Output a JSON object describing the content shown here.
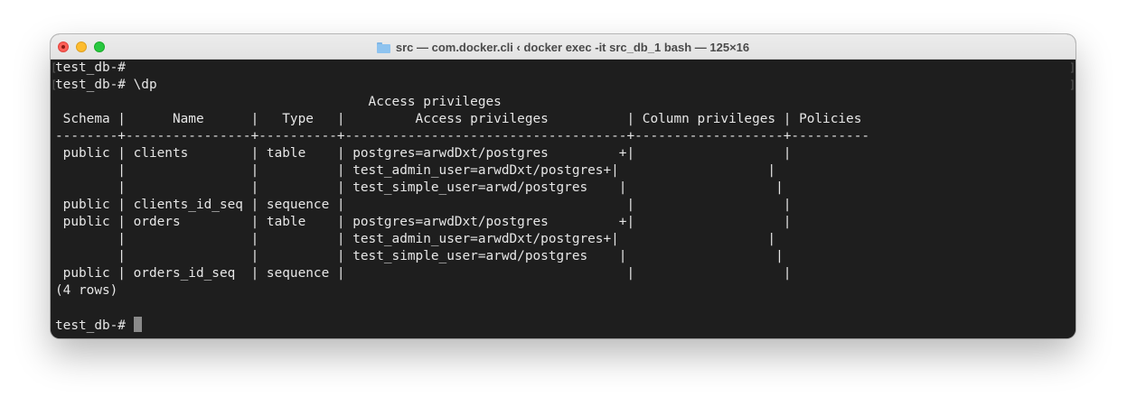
{
  "window": {
    "title": "src — com.docker.cli ‹ docker exec -it src_db_1 bash — 125×16"
  },
  "terminal": {
    "lines": [
      "test_db-#",
      "test_db-# \\dp",
      "                                        Access privileges",
      " Schema |      Name      |   Type   |         Access privileges          | Column privileges | Policies",
      "--------+----------------+----------+------------------------------------+-------------------+----------",
      " public | clients        | table    | postgres=arwdDxt/postgres         +|                   |",
      "        |                |          | test_admin_user=arwdDxt/postgres+|                   |",
      "        |                |          | test_simple_user=arwd/postgres    |                   |",
      " public | clients_id_seq | sequence |                                    |                   |",
      " public | orders         | table    | postgres=arwdDxt/postgres         +|                   |",
      "        |                |          | test_admin_user=arwdDxt/postgres+|                   |",
      "        |                |          | test_simple_user=arwd/postgres    |                   |",
      " public | orders_id_seq  | sequence |                                    |                   |",
      "(4 rows)",
      "",
      "test_db-# "
    ]
  },
  "colors": {
    "terminal_bg": "#1e1e1e",
    "terminal_fg": "#e6e6e6",
    "close": "#fe5f57",
    "minimize": "#febc2e",
    "maximize": "#28c840"
  },
  "icons": {
    "title_icon": "folder-icon"
  }
}
